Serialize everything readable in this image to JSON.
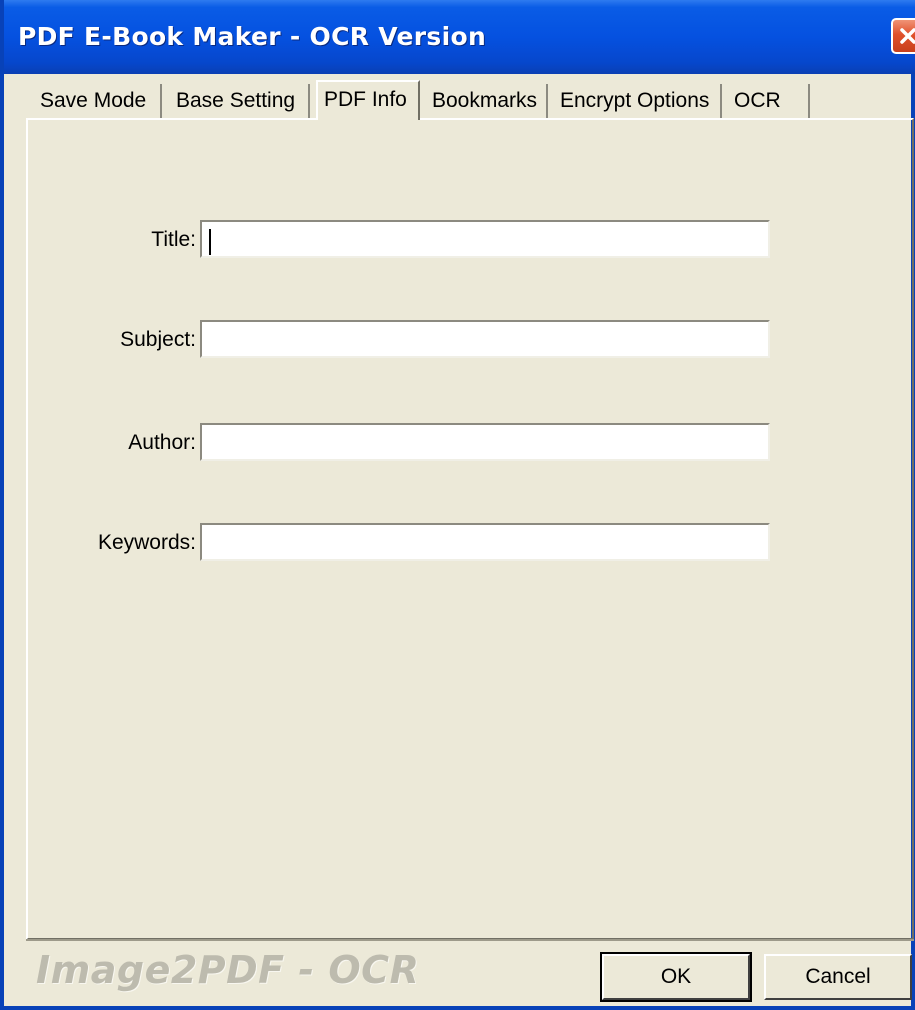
{
  "window": {
    "title": "PDF E-Book Maker - OCR Version"
  },
  "tabs": [
    {
      "label": "Save Mode",
      "active": false
    },
    {
      "label": "Base Setting",
      "active": false
    },
    {
      "label": "PDF Info",
      "active": true
    },
    {
      "label": "Bookmarks",
      "active": false
    },
    {
      "label": "Encrypt Options",
      "active": false
    },
    {
      "label": "OCR",
      "active": false
    }
  ],
  "form": {
    "title_label": "Title:",
    "title_value": "",
    "subject_label": "Subject:",
    "subject_value": "",
    "author_label": "Author:",
    "author_value": "",
    "keywords_label": "Keywords:",
    "keywords_value": ""
  },
  "footer": {
    "brand": "Image2PDF - OCR",
    "ok_label": "OK",
    "cancel_label": "Cancel"
  },
  "colors": {
    "titlebar": "#0551e0",
    "dialog_bg": "#ece9d8",
    "close_button": "#e0512c"
  },
  "icons": {
    "close": "close-icon"
  }
}
